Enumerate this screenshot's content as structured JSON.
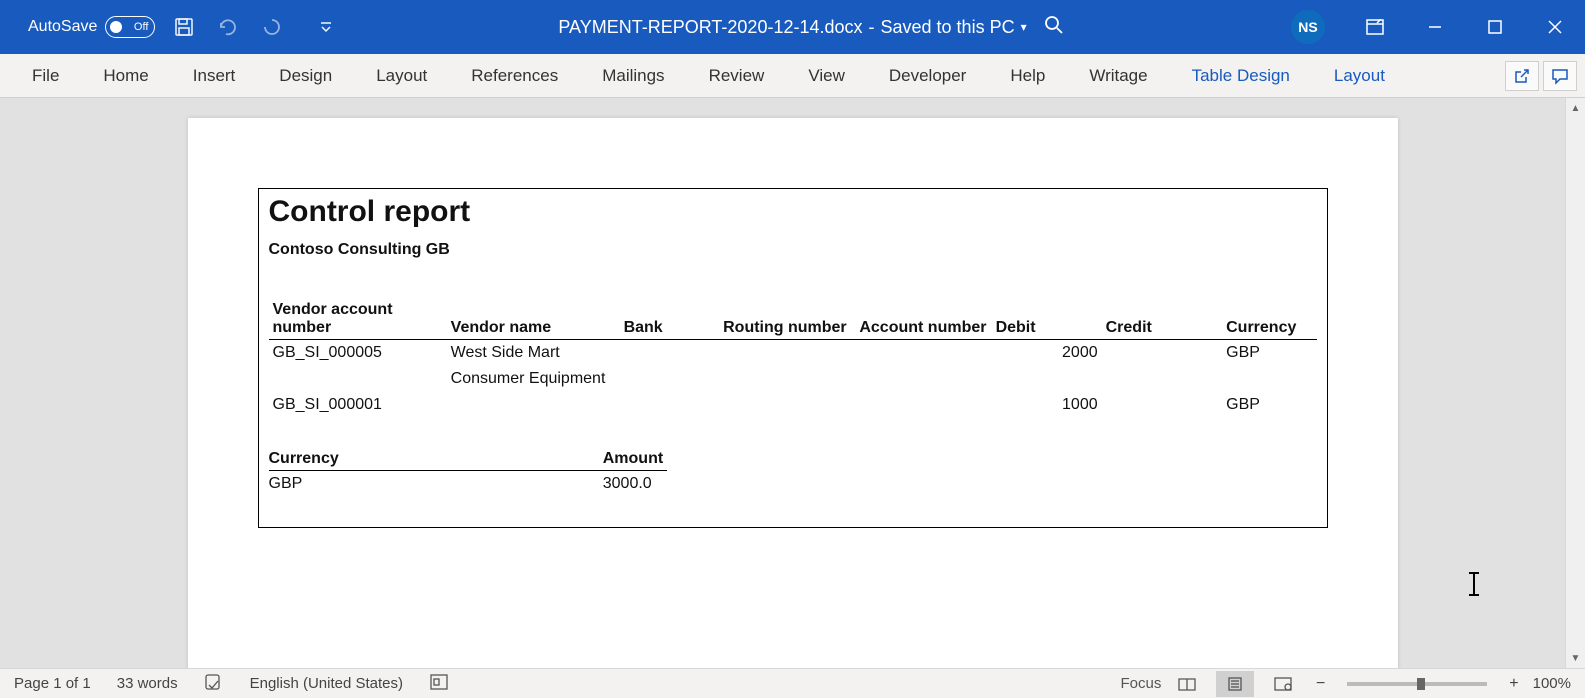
{
  "titlebar": {
    "autosave_label": "AutoSave",
    "autosave_state": "Off",
    "doc_name": "PAYMENT-REPORT-2020-12-14.docx",
    "save_status": "Saved to this PC",
    "user_initials": "NS"
  },
  "ribbon": {
    "tabs": [
      "File",
      "Home",
      "Insert",
      "Design",
      "Layout",
      "References",
      "Mailings",
      "Review",
      "View",
      "Developer",
      "Help",
      "Writage"
    ],
    "contextual_tabs": [
      "Table Design",
      "Layout"
    ]
  },
  "report": {
    "title": "Control report",
    "company": "Contoso Consulting GB",
    "headers": {
      "vendor_account": "Vendor account number",
      "vendor_name": "Vendor name",
      "bank": "Bank",
      "routing": "Routing number",
      "account": "Account number",
      "debit": "Debit",
      "credit": "Credit",
      "currency": "Currency"
    },
    "rows": [
      {
        "vendor_account": "GB_SI_000005",
        "vendor_name": "West Side Mart",
        "bank": "",
        "routing": "",
        "account": "",
        "debit": "2000",
        "credit": "",
        "currency": "GBP"
      },
      {
        "vendor_account": "GB_SI_000001",
        "vendor_name": "Consumer Equipment",
        "bank": "",
        "routing": "",
        "account": "",
        "debit": "1000",
        "credit": "",
        "currency": "GBP"
      }
    ],
    "summary_headers": {
      "currency": "Currency",
      "amount": "Amount"
    },
    "summary_rows": [
      {
        "currency": "GBP",
        "amount": "3000.0"
      }
    ]
  },
  "statusbar": {
    "page": "Page 1 of 1",
    "words": "33 words",
    "language": "English (United States)",
    "focus": "Focus",
    "zoom": "100%"
  }
}
